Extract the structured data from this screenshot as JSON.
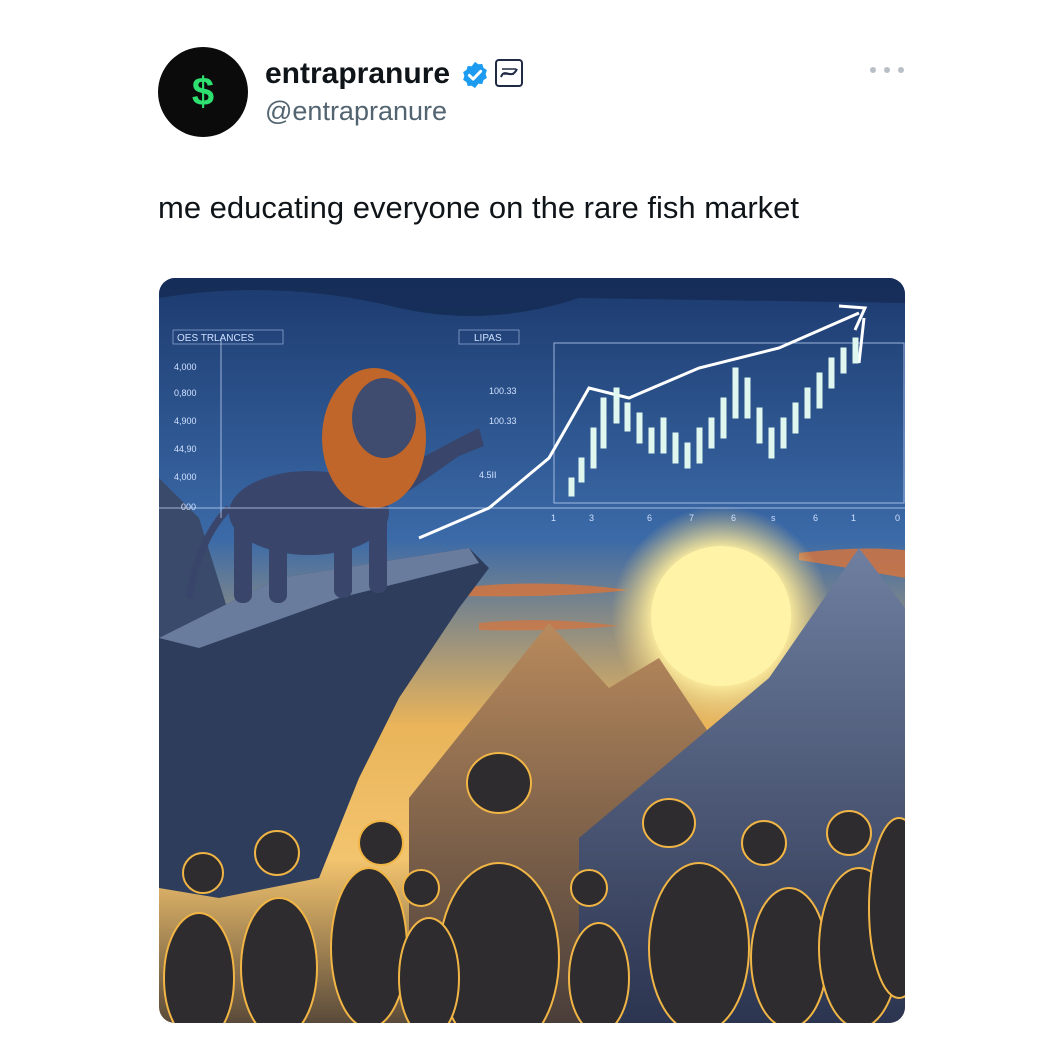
{
  "author": {
    "avatar_symbol": "$",
    "display_name": "entrapranure",
    "handle": "@entrapranure",
    "verified_icon": "verified-check-icon",
    "verified_color": "#1d9bf0",
    "affiliate_icon": "affiliate-badge-icon"
  },
  "actions": {
    "more_icon": "more-dots-icon"
  },
  "tweet": {
    "text": "me educating everyone on the rare fish market"
  },
  "media": {
    "description_icon": "meme-image",
    "chart_left_title": "OES TRLANCES",
    "chart_right_title": "LIPAS",
    "left_axis_labels": [
      "4,000",
      "0,800",
      "4,900",
      "44,90",
      "4,000",
      "000"
    ],
    "mid_axis_labels": [
      "100.33",
      "100.33",
      "4.5II"
    ],
    "bottom_axis_labels": [
      "1",
      "3",
      "6",
      "7",
      "6",
      "s",
      "6",
      "1",
      "0"
    ],
    "colors": {
      "accent_green": "#2ee06f",
      "sky_top": "#1c3a6e",
      "sun": "#fff3a8"
    }
  }
}
